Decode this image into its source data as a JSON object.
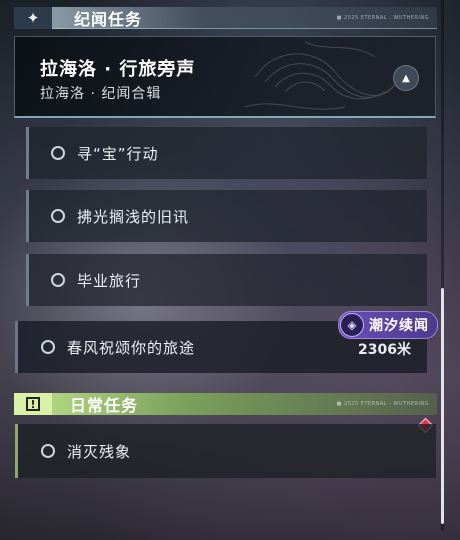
{
  "story_category": {
    "title": "纪闻任务",
    "icon": "sparkle-icon",
    "deco_text": "■ 2025 ETERNAL · WUTHERING"
  },
  "story_card": {
    "title": "拉海洛 · 行旅旁声",
    "subtitle": "拉海洛 · 纪闻合辑",
    "nav_icon": "navigate-arrow-icon"
  },
  "sub_quests": [
    {
      "label": "寻“宝”行动"
    },
    {
      "label": "拂光搁浅的旧讯"
    },
    {
      "label": "毕业旅行"
    }
  ],
  "main_quest": {
    "label": "春风祝颂你的旅途",
    "badge": "潮汐续闻",
    "badge_icon": "tide-icon",
    "distance": "2306米"
  },
  "daily_category": {
    "title": "日常任务",
    "icon": "exclamation-box-icon",
    "deco_text": "■ 2025 ETERNAL · WUTHERING"
  },
  "daily_quests": [
    {
      "label": "消灭残象",
      "marker": "red-diamond-marker"
    }
  ],
  "colors": {
    "story_accent": "#a7e3ee",
    "daily_accent": "#bfe38c",
    "tide_badge": "#6a4fb8",
    "marker_red": "#e0364f"
  }
}
